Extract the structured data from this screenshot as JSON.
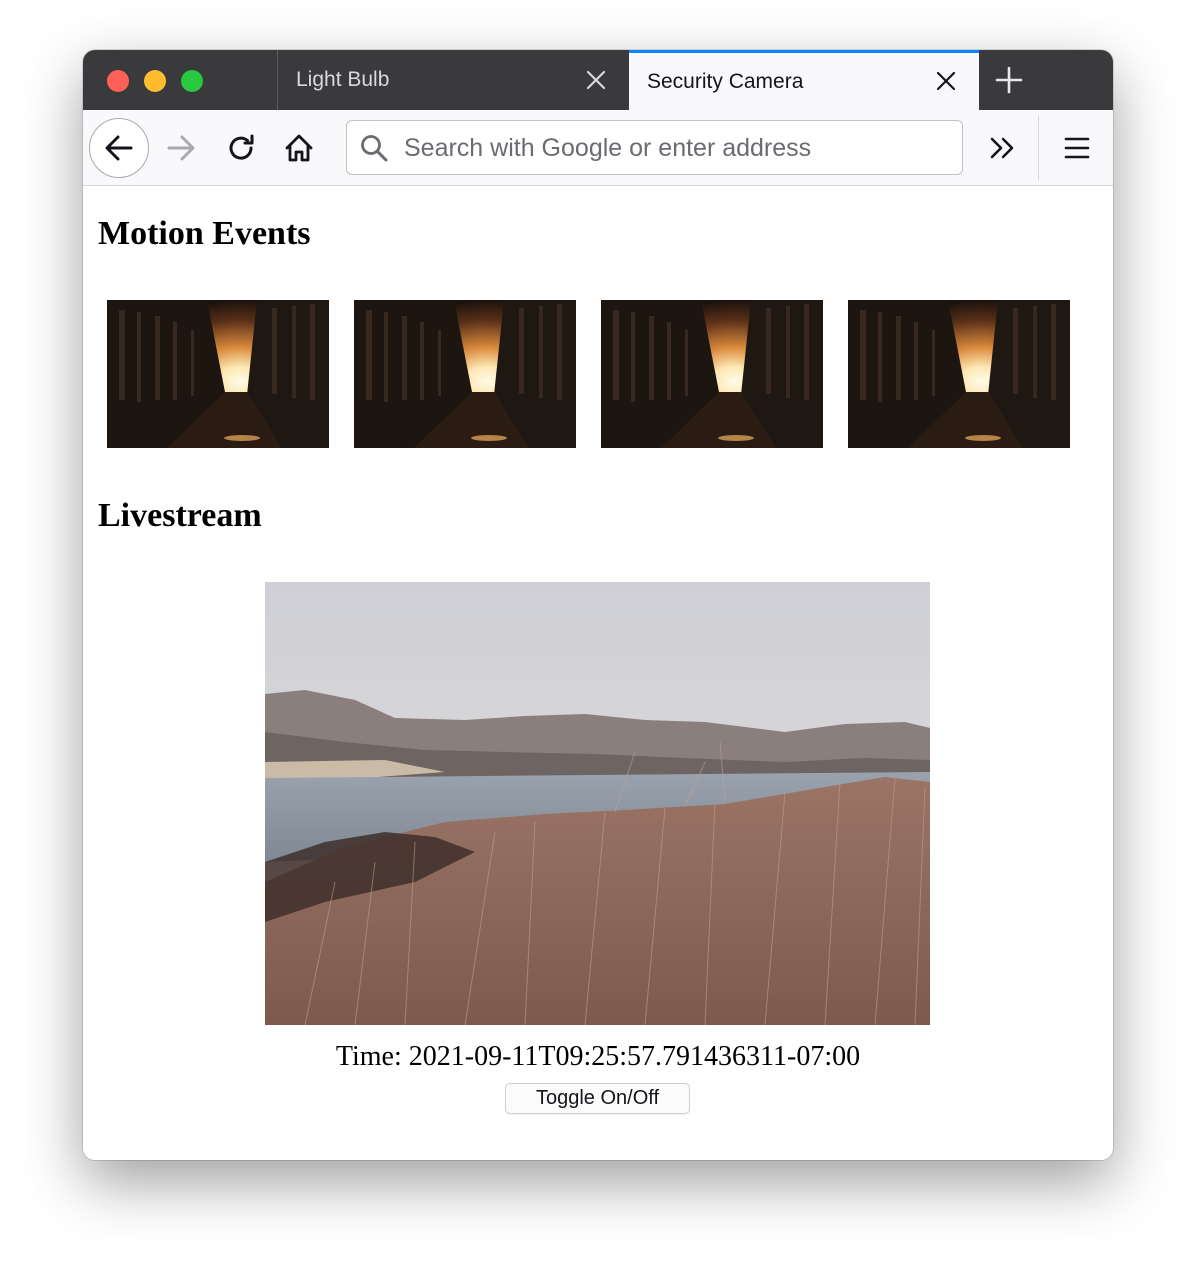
{
  "tabs": [
    {
      "label": "Light Bulb",
      "active": false
    },
    {
      "label": "Security Camera",
      "active": true
    }
  ],
  "toolbar": {
    "url_placeholder": "Search with Google or enter address"
  },
  "page": {
    "motion_heading": "Motion Events",
    "livestream_heading": "Livestream",
    "time_text": "Time: 2021-09-11T09:25:57.791436311-07:00",
    "toggle_label": "Toggle On/Off"
  },
  "colors": {
    "tab_strip": "#3a3a3d",
    "active_tab_accent": "#0a84ff",
    "toolbar": "#f9f9fb"
  },
  "icons": [
    "back-arrow-icon",
    "forward-arrow-icon",
    "reload-icon",
    "home-icon",
    "search-icon",
    "close-icon",
    "plus-icon",
    "chevron-double-right-icon",
    "hamburger-menu-icon"
  ]
}
